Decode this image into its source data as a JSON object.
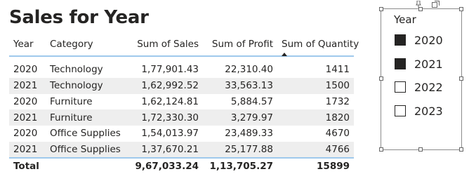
{
  "visual": {
    "title": "Sales for Year"
  },
  "table": {
    "columns": [
      "Year",
      "Category",
      "Sum of Sales",
      "Sum of Profit",
      "Sum of Quantity"
    ],
    "rows": [
      [
        "2020",
        "Technology",
        "1,77,901.43",
        "22,310.40",
        "1411"
      ],
      [
        "2021",
        "Technology",
        "1,62,992.52",
        "33,563.13",
        "1500"
      ],
      [
        "2020",
        "Furniture",
        "1,62,124.81",
        "5,884.57",
        "1732"
      ],
      [
        "2021",
        "Furniture",
        "1,72,330.30",
        "3,279.97",
        "1820"
      ],
      [
        "2020",
        "Office Supplies",
        "1,54,013.97",
        "23,489.33",
        "4670"
      ],
      [
        "2021",
        "Office Supplies",
        "1,37,670.21",
        "25,177.88",
        "4766"
      ]
    ],
    "total": {
      "label": "Total",
      "sales": "9,67,033.24",
      "profit": "1,13,705.27",
      "quantity": "15899"
    },
    "sort_column": "Sum of Quantity"
  },
  "slicer": {
    "title": "Year",
    "items": [
      {
        "label": "2020",
        "checked": true
      },
      {
        "label": "2021",
        "checked": true
      },
      {
        "label": "2022",
        "checked": false
      },
      {
        "label": "2023",
        "checked": false
      }
    ]
  },
  "colors": {
    "header_rule": "#9fc9ec",
    "stripe": "#eeeeee",
    "text": "#252423"
  },
  "icons": [
    "sort-ascending-icon",
    "pin-icon",
    "focus-mode-icon"
  ]
}
